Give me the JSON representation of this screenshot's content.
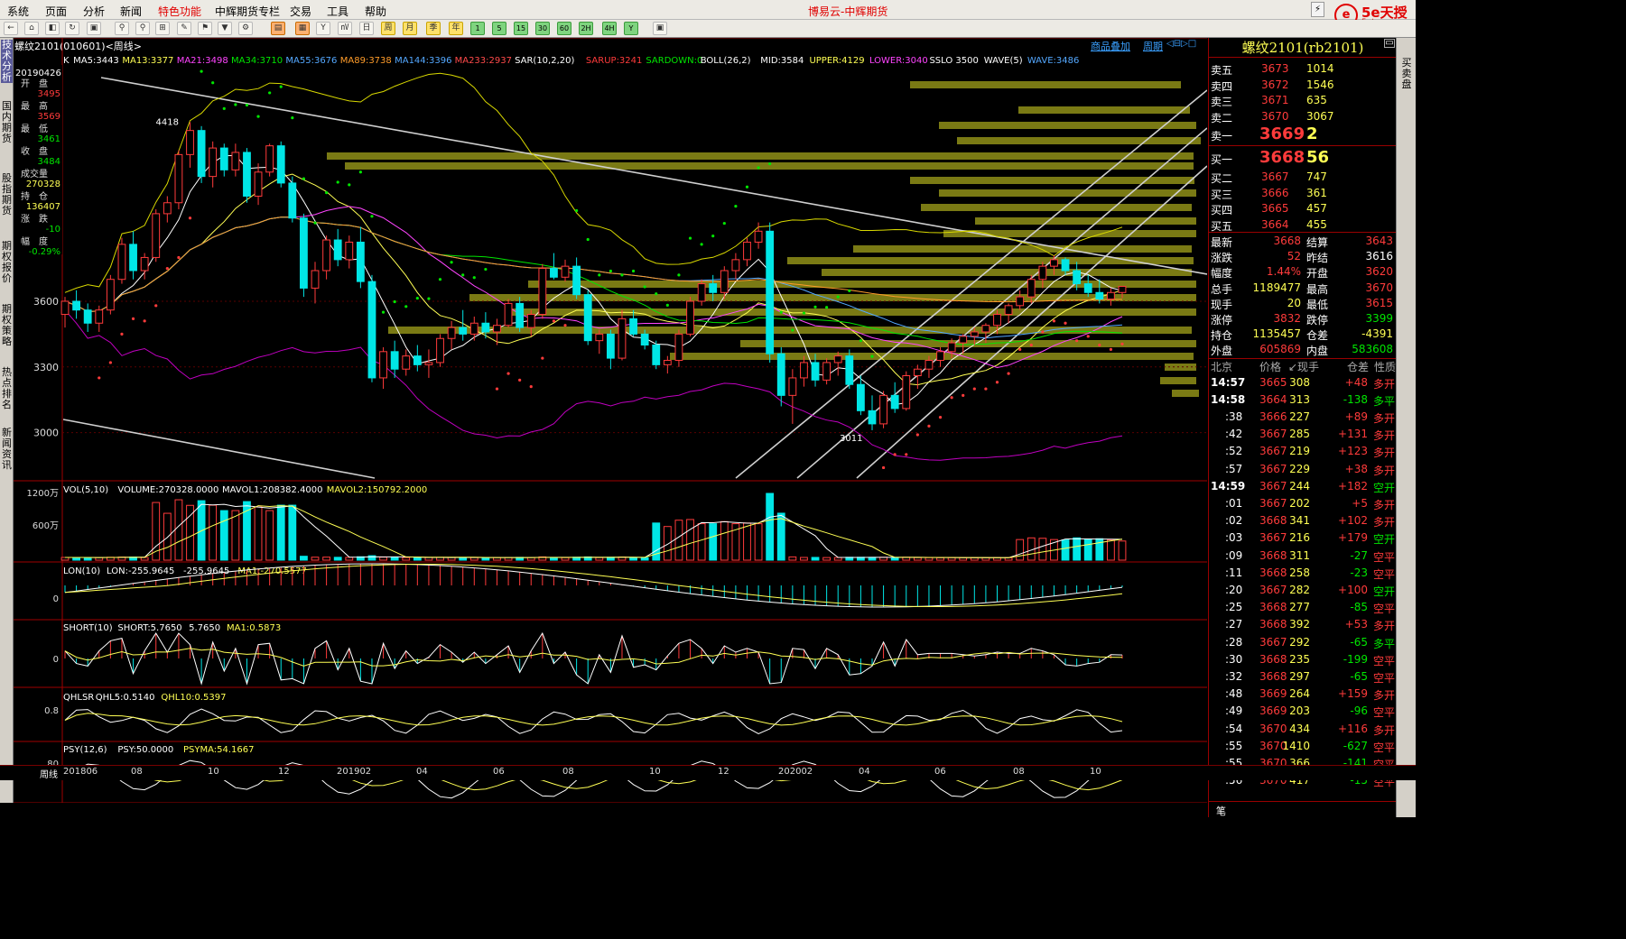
{
  "menu": {
    "items": [
      "系统",
      "页面",
      "分析",
      "新闻",
      "特色功能",
      "中辉期货专栏",
      "交易",
      "工具",
      "帮助"
    ],
    "highlight": "特色功能",
    "app_title": "博易云-中辉期货"
  },
  "logo": {
    "mark": "e",
    "brand": "5e天授",
    "sub": "5etz.com"
  },
  "toolbar": {
    "buttons": [
      "←",
      "⌂",
      "◧",
      "↻",
      "▣",
      "⚲",
      "⚲",
      "⊞",
      "✎",
      "⚑",
      "▼",
      "⚙",
      "▤",
      "▦",
      "Y",
      "㎵",
      "日",
      "周",
      "月",
      "季",
      "年",
      "1",
      "5",
      "15",
      "30",
      "60",
      "2H",
      "4H",
      "Y",
      "▣"
    ]
  },
  "sidetabs": [
    {
      "label": "技术分析",
      "active": true
    },
    {
      "label": "国内期货",
      "active": false
    },
    {
      "label": "股指期货",
      "active": false
    },
    {
      "label": "期权报价",
      "active": false
    },
    {
      "label": "期权策略",
      "active": false
    },
    {
      "label": "热点排名",
      "active": false
    },
    {
      "label": "新闻资讯",
      "active": false
    }
  ],
  "chart_header": {
    "title": "螺纹2101(010601)<周线>",
    "tabs": [
      "商品叠加",
      "周期"
    ]
  },
  "info_box": {
    "date": "20190426",
    "rows": [
      {
        "label": "开　盘",
        "value": "3495",
        "color": "#ff3b3b"
      },
      {
        "label": "最　高",
        "value": "3569",
        "color": "#ff3b3b"
      },
      {
        "label": "最　低",
        "value": "3461",
        "color": "#00e600"
      },
      {
        "label": "收　盘",
        "value": "3484",
        "color": "#00e600"
      },
      {
        "label": "成交量",
        "value": "270328",
        "color": "#ffff54"
      },
      {
        "label": "持　仓",
        "value": "136407",
        "color": "#ffff54"
      },
      {
        "label": "涨　跌",
        "value": "-10",
        "color": "#00e600"
      },
      {
        "label": "幅　度",
        "value": "-0.29%",
        "color": "#00e600"
      }
    ]
  },
  "indicator_lines": {
    "main": [
      {
        "t": "K",
        "c": "#ffffff"
      },
      {
        "t": "MA5:3443",
        "c": "#ffffff"
      },
      {
        "t": "MA13:3377",
        "c": "#ffff54"
      },
      {
        "t": "MA21:3498",
        "c": "#ff44ff"
      },
      {
        "t": "MA34:3710",
        "c": "#00e600"
      },
      {
        "t": "MA55:3676",
        "c": "#54a8ff"
      },
      {
        "t": "MA89:3738",
        "c": "#ff9c2a"
      },
      {
        "t": "MA144:3396",
        "c": "#54a8ff"
      },
      {
        "t": "MA233:2937",
        "c": "#ff4a4a"
      },
      {
        "t": "SAR(10,2,20)",
        "c": "#ffffff"
      },
      {
        "t": "SARUP:3241",
        "c": "#ff3b3b"
      },
      {
        "t": "SARDOWN:0",
        "c": "#00e600"
      },
      {
        "t": "BOLL(26,2)",
        "c": "#ffffff"
      },
      {
        "t": "MID:3584",
        "c": "#ffffff"
      },
      {
        "t": "UPPER:4129",
        "c": "#ffff54"
      },
      {
        "t": "LOWER:3040",
        "c": "#ff44ff"
      },
      {
        "t": "SSLO 3500",
        "c": "#ffffff"
      },
      {
        "t": "WAVE(5)",
        "c": "#ffffff"
      },
      {
        "t": "WAVE:3486",
        "c": "#54a8ff"
      }
    ],
    "vol": [
      {
        "t": "VOL(5,10)",
        "c": "#ffffff"
      },
      {
        "t": "VOLUME:270328.0000",
        "c": "#ffffff"
      },
      {
        "t": "MAVOL1:208382.4000",
        "c": "#ffffff"
      },
      {
        "t": "MAVOL2:150792.2000",
        "c": "#ffff54"
      }
    ],
    "lon": [
      {
        "t": "LON(10)",
        "c": "#ffffff"
      },
      {
        "t": "LON:-255.9645",
        "c": "#ffffff"
      },
      {
        "t": "-255.9645",
        "c": "#ffffff"
      },
      {
        "t": "MA1:-270.5577",
        "c": "#ffff54"
      }
    ],
    "short": [
      {
        "t": "SHORT(10)",
        "c": "#ffffff"
      },
      {
        "t": "SHORT:5.7650",
        "c": "#ffffff"
      },
      {
        "t": "5.7650",
        "c": "#ffffff"
      },
      {
        "t": "MA1:0.5873",
        "c": "#ffff54"
      }
    ],
    "qhlsr": [
      {
        "t": "QHLSR",
        "c": "#ffffff"
      },
      {
        "t": "QHL5:0.5140",
        "c": "#ffffff"
      },
      {
        "t": "QHL10:0.5397",
        "c": "#ffff54"
      }
    ],
    "psy": [
      {
        "t": "PSY(12,6)",
        "c": "#ffffff"
      },
      {
        "t": "PSY:50.0000",
        "c": "#ffffff"
      },
      {
        "t": "PSYMA:54.1667",
        "c": "#ffff54"
      }
    ]
  },
  "chart_data": {
    "type": "candlestick",
    "period": "weekly",
    "symbol": "螺纹2101",
    "price_axis": {
      "ticks": [
        3000,
        3300,
        3600
      ],
      "range": [
        2780,
        4700
      ]
    },
    "annotations": [
      {
        "label": "4418",
        "value": 4418
      },
      {
        "label": "3011",
        "value": 3011
      }
    ],
    "x_axis_labels": [
      "201806",
      "08",
      "10",
      "12",
      "201902",
      "04",
      "06",
      "08",
      "10",
      "12",
      "202002",
      "04",
      "06",
      "08",
      "10"
    ],
    "candles": [
      [
        3540,
        3620,
        3480,
        3600
      ],
      [
        3600,
        3650,
        3520,
        3560
      ],
      [
        3560,
        3590,
        3460,
        3500
      ],
      [
        3500,
        3580,
        3460,
        3560
      ],
      [
        3560,
        3720,
        3540,
        3700
      ],
      [
        3700,
        3890,
        3680,
        3860
      ],
      [
        3860,
        3920,
        3700,
        3740
      ],
      [
        3740,
        3820,
        3700,
        3800
      ],
      [
        3800,
        4020,
        3780,
        4000
      ],
      [
        4000,
        4080,
        3960,
        4050
      ],
      [
        4050,
        4290,
        4020,
        4270
      ],
      [
        4270,
        4418,
        4210,
        4380
      ],
      [
        4380,
        4400,
        4140,
        4170
      ],
      [
        4170,
        4330,
        4120,
        4300
      ],
      [
        4300,
        4320,
        4170,
        4200
      ],
      [
        4200,
        4320,
        4170,
        4280
      ],
      [
        4280,
        4300,
        4050,
        4080
      ],
      [
        4080,
        4230,
        4040,
        4190
      ],
      [
        4190,
        4320,
        4170,
        4310
      ],
      [
        4310,
        4330,
        4120,
        4140
      ],
      [
        4140,
        4170,
        3960,
        3980
      ],
      [
        3980,
        4000,
        3620,
        3660
      ],
      [
        3660,
        3780,
        3590,
        3740
      ],
      [
        3740,
        3900,
        3700,
        3880
      ],
      [
        3880,
        3930,
        3760,
        3790
      ],
      [
        3790,
        3900,
        3750,
        3870
      ],
      [
        3870,
        3940,
        3660,
        3690
      ],
      [
        3690,
        3720,
        3230,
        3250
      ],
      [
        3250,
        3390,
        3200,
        3370
      ],
      [
        3370,
        3420,
        3250,
        3290
      ],
      [
        3290,
        3380,
        3260,
        3350
      ],
      [
        3350,
        3400,
        3280,
        3310
      ],
      [
        3310,
        3380,
        3250,
        3320
      ],
      [
        3320,
        3450,
        3300,
        3430
      ],
      [
        3430,
        3510,
        3380,
        3480
      ],
      [
        3480,
        3560,
        3420,
        3450
      ],
      [
        3450,
        3530,
        3420,
        3500
      ],
      [
        3500,
        3550,
        3430,
        3460
      ],
      [
        3460,
        3520,
        3400,
        3490
      ],
      [
        3490,
        3610,
        3480,
        3590
      ],
      [
        3590,
        3620,
        3460,
        3480
      ],
      [
        3480,
        3560,
        3440,
        3540
      ],
      [
        3540,
        3770,
        3520,
        3750
      ],
      [
        3750,
        3820,
        3700,
        3710
      ],
      [
        3710,
        3790,
        3690,
        3760
      ],
      [
        3760,
        3800,
        3610,
        3630
      ],
      [
        3630,
        3650,
        3400,
        3420
      ],
      [
        3420,
        3470,
        3360,
        3450
      ],
      [
        3450,
        3470,
        3290,
        3340
      ],
      [
        3340,
        3560,
        3330,
        3520
      ],
      [
        3520,
        3560,
        3440,
        3450
      ],
      [
        3450,
        3470,
        3380,
        3400
      ],
      [
        3400,
        3420,
        3290,
        3310
      ],
      [
        3310,
        3350,
        3270,
        3330
      ],
      [
        3330,
        3470,
        3300,
        3450
      ],
      [
        3450,
        3620,
        3440,
        3600
      ],
      [
        3600,
        3700,
        3580,
        3680
      ],
      [
        3680,
        3720,
        3600,
        3640
      ],
      [
        3640,
        3760,
        3610,
        3740
      ],
      [
        3740,
        3820,
        3700,
        3790
      ],
      [
        3790,
        3890,
        3760,
        3870
      ],
      [
        3870,
        3960,
        3840,
        3920
      ],
      [
        3920,
        3960,
        3320,
        3360
      ],
      [
        3360,
        3390,
        3120,
        3170
      ],
      [
        3170,
        3290,
        3040,
        3250
      ],
      [
        3250,
        3350,
        3210,
        3320
      ],
      [
        3320,
        3360,
        3210,
        3240
      ],
      [
        3240,
        3340,
        3220,
        3320
      ],
      [
        3320,
        3370,
        3260,
        3350
      ],
      [
        3350,
        3380,
        3200,
        3220
      ],
      [
        3220,
        3260,
        3080,
        3100
      ],
      [
        3100,
        3170,
        3011,
        3040
      ],
      [
        3040,
        3190,
        3020,
        3170
      ],
      [
        3170,
        3230,
        3090,
        3110
      ],
      [
        3110,
        3280,
        3100,
        3260
      ],
      [
        3260,
        3310,
        3200,
        3290
      ],
      [
        3290,
        3350,
        3250,
        3330
      ],
      [
        3330,
        3390,
        3300,
        3370
      ],
      [
        3370,
        3430,
        3340,
        3410
      ],
      [
        3410,
        3450,
        3360,
        3440
      ],
      [
        3440,
        3480,
        3400,
        3460
      ],
      [
        3460,
        3500,
        3410,
        3490
      ],
      [
        3490,
        3560,
        3450,
        3540
      ],
      [
        3540,
        3590,
        3500,
        3580
      ],
      [
        3580,
        3650,
        3560,
        3620
      ],
      [
        3620,
        3720,
        3590,
        3700
      ],
      [
        3700,
        3780,
        3660,
        3760
      ],
      [
        3760,
        3810,
        3720,
        3790
      ],
      [
        3790,
        3800,
        3720,
        3740
      ],
      [
        3740,
        3780,
        3650,
        3680
      ],
      [
        3680,
        3720,
        3620,
        3640
      ],
      [
        3640,
        3700,
        3590,
        3610
      ],
      [
        3610,
        3660,
        3580,
        3640
      ],
      [
        3640,
        3670,
        3615,
        3668
      ]
    ],
    "volume_axis": {
      "ticks": [
        "600万",
        "1200万"
      ]
    },
    "lon_axis": {
      "ticks": [
        "0"
      ]
    },
    "short_axis": {
      "ticks": [
        "0"
      ]
    },
    "qhlsr_axis": {
      "ticks": [
        "0.8"
      ]
    },
    "psy_axis": {
      "ticks": [
        "80"
      ]
    }
  },
  "quote": {
    "title": "螺纹2101(rb2101)",
    "asks": [
      {
        "label": "卖五",
        "price": "3673",
        "vol": "1014"
      },
      {
        "label": "卖四",
        "price": "3672",
        "vol": "1546"
      },
      {
        "label": "卖三",
        "price": "3671",
        "vol": "635"
      },
      {
        "label": "卖二",
        "price": "3670",
        "vol": "3067"
      },
      {
        "label": "卖一",
        "price": "3669",
        "vol": "2"
      }
    ],
    "bids": [
      {
        "label": "买一",
        "price": "3668",
        "vol": "56"
      },
      {
        "label": "买二",
        "price": "3667",
        "vol": "747"
      },
      {
        "label": "买三",
        "price": "3666",
        "vol": "361"
      },
      {
        "label": "买四",
        "price": "3665",
        "vol": "457"
      },
      {
        "label": "买五",
        "price": "3664",
        "vol": "455"
      }
    ],
    "stats": [
      {
        "l1": "最新",
        "v1": "3668",
        "c1": "#ff3b3b",
        "l2": "结算",
        "v2": "3643",
        "c2": "#ff3b3b"
      },
      {
        "l1": "涨跌",
        "v1": "52",
        "c1": "#ff3b3b",
        "l2": "昨结",
        "v2": "3616",
        "c2": "#ffffff"
      },
      {
        "l1": "幅度",
        "v1": "1.44%",
        "c1": "#ff3b3b",
        "l2": "开盘",
        "v2": "3620",
        "c2": "#ff3b3b"
      },
      {
        "l1": "总手",
        "v1": "1189477",
        "c1": "#ffff54",
        "l2": "最高",
        "v2": "3670",
        "c2": "#ff3b3b"
      },
      {
        "l1": "现手",
        "v1": "20",
        "c1": "#ffff54",
        "l2": "最低",
        "v2": "3615",
        "c2": "#ff3b3b"
      },
      {
        "l1": "涨停",
        "v1": "3832",
        "c1": "#ff3b3b",
        "l2": "跌停",
        "v2": "3399",
        "c2": "#00e600"
      },
      {
        "l1": "持仓",
        "v1": "1135457",
        "c1": "#ffff54",
        "l2": "仓差",
        "v2": "-4391",
        "c2": "#ffff54"
      },
      {
        "l1": "外盘",
        "v1": "605869",
        "c1": "#ff3b3b",
        "l2": "内盘",
        "v2": "583608",
        "c2": "#00e600"
      }
    ],
    "ticks_header": [
      "北京",
      "价格",
      "↙现手",
      "仓差",
      "性质"
    ],
    "ticks": [
      {
        "t": "14:57",
        "p": "3665",
        "v": "308",
        "d": "+48",
        "n": "多开"
      },
      {
        "t": "14:58",
        "p": "3664",
        "v": "313",
        "d": "-138",
        "n": "多平"
      },
      {
        "t": ":38",
        "p": "3666",
        "v": "227",
        "d": "+89",
        "n": "多开"
      },
      {
        "t": ":42",
        "p": "3667",
        "v": "285",
        "d": "+131",
        "n": "多开"
      },
      {
        "t": ":52",
        "p": "3667",
        "v": "219",
        "d": "+123",
        "n": "多开"
      },
      {
        "t": ":57",
        "p": "3667",
        "v": "229",
        "d": "+38",
        "n": "多开"
      },
      {
        "t": "14:59",
        "p": "3667",
        "v": "244",
        "d": "+182",
        "n": "空开"
      },
      {
        "t": ":01",
        "p": "3667",
        "v": "202",
        "d": "+5",
        "n": "多开"
      },
      {
        "t": ":02",
        "p": "3668",
        "v": "341",
        "d": "+102",
        "n": "多开"
      },
      {
        "t": ":03",
        "p": "3667",
        "v": "216",
        "d": "+179",
        "n": "空开"
      },
      {
        "t": ":09",
        "p": "3668",
        "v": "311",
        "d": "-27",
        "n": "空平"
      },
      {
        "t": ":11",
        "p": "3668",
        "v": "258",
        "d": "-23",
        "n": "空平"
      },
      {
        "t": ":20",
        "p": "3667",
        "v": "282",
        "d": "+100",
        "n": "空开"
      },
      {
        "t": ":25",
        "p": "3668",
        "v": "277",
        "d": "-85",
        "n": "空平"
      },
      {
        "t": ":27",
        "p": "3668",
        "v": "392",
        "d": "+53",
        "n": "多开"
      },
      {
        "t": ":28",
        "p": "3667",
        "v": "292",
        "d": "-65",
        "n": "多平"
      },
      {
        "t": ":30",
        "p": "3668",
        "v": "235",
        "d": "-199",
        "n": "空平"
      },
      {
        "t": ":32",
        "p": "3668",
        "v": "297",
        "d": "-65",
        "n": "空平"
      },
      {
        "t": ":48",
        "p": "3669",
        "v": "264",
        "d": "+159",
        "n": "多开"
      },
      {
        "t": ":49",
        "p": "3669",
        "v": "203",
        "d": "-96",
        "n": "空平"
      },
      {
        "t": ":54",
        "p": "3670",
        "v": "434",
        "d": "+116",
        "n": "多开"
      },
      {
        "t": ":55",
        "p": "3670",
        "v": "1410",
        "d": "-627",
        "n": "空平"
      },
      {
        "t": ":55",
        "p": "3670",
        "v": "366",
        "d": "-141",
        "n": "空平"
      },
      {
        "t": ":56",
        "p": "3670",
        "v": "417",
        "d": "-15",
        "n": "空平"
      }
    ],
    "bottom_label": "笔"
  },
  "right_scroll_label": "买卖盘",
  "bottom_left": "周线"
}
